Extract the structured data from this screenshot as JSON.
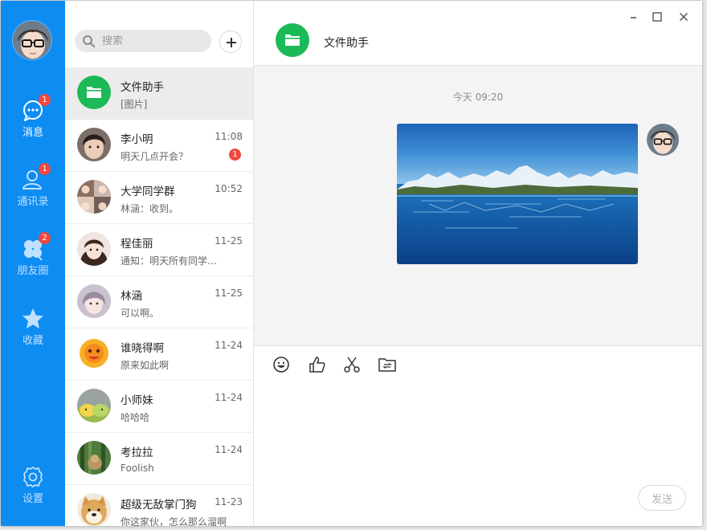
{
  "nav": {
    "items": [
      {
        "label": "消息",
        "badge": "1",
        "icon": "chat-icon"
      },
      {
        "label": "通讯录",
        "badge": "1",
        "icon": "contacts-icon"
      },
      {
        "label": "朋友圈",
        "badge": "2",
        "icon": "clover-icon"
      },
      {
        "label": "收藏",
        "badge": "",
        "icon": "star-icon"
      }
    ],
    "settings_label": "设置"
  },
  "search": {
    "placeholder": "搜索"
  },
  "conversations": [
    {
      "name": "文件助手",
      "preview": "[图片]",
      "time": "",
      "badge": ""
    },
    {
      "name": "李小明",
      "preview": "明天几点开会？",
      "time": "11:08",
      "badge": "1"
    },
    {
      "name": "大学同学群",
      "preview": "林涵：收到。",
      "time": "10:52",
      "badge": ""
    },
    {
      "name": "程佳丽",
      "preview": "通知：明天所有同学请按时到校参加活动",
      "time": "11-25",
      "badge": ""
    },
    {
      "name": "林涵",
      "preview": "可以啊。",
      "time": "11-25",
      "badge": ""
    },
    {
      "name": "谁晓得啊",
      "preview": "原来如此啊",
      "time": "11-24",
      "badge": ""
    },
    {
      "name": "小师妹",
      "preview": "哈哈哈",
      "time": "11-24",
      "badge": ""
    },
    {
      "name": "考拉拉",
      "preview": "Foolish",
      "time": "11-24",
      "badge": ""
    },
    {
      "name": "超级无敌掌门狗",
      "preview": "你这家伙，怎么那么溜啊",
      "time": "11-23",
      "badge": ""
    }
  ],
  "chat": {
    "title": "文件助手",
    "timestamp": "今天 09:20",
    "send_label": "发送"
  },
  "colors": {
    "nav_bg": "#0d8cf2",
    "badge": "#f2473e",
    "file_helper_green": "#1cb957",
    "messages_bg": "#f4f4f5"
  }
}
